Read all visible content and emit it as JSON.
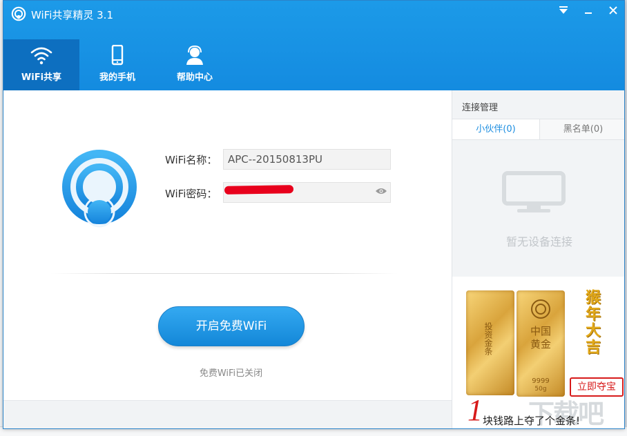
{
  "window": {
    "title": "WiFi共享精灵 3.1"
  },
  "nav": {
    "tabs": [
      {
        "label": "WiFi共享",
        "icon": "wifi-icon",
        "active": true
      },
      {
        "label": "我的手机",
        "icon": "phone-icon",
        "active": false
      },
      {
        "label": "帮助中心",
        "icon": "support-agent-icon",
        "active": false
      }
    ]
  },
  "main": {
    "wifi_name_label": "WiFi名称：",
    "wifi_name_value": "APC--20150813PU",
    "wifi_password_label": "WiFi密码：",
    "start_button": "开启免费WiFi",
    "status": "免费WiFi已关闭"
  },
  "side": {
    "title": "连接管理",
    "tabs": [
      {
        "label": "小伙伴(0)",
        "active": true
      },
      {
        "label": "黑名单(0)",
        "active": false
      }
    ],
    "empty_text": "暂无设备连接"
  },
  "ad": {
    "bar1_text": "投资金条",
    "bar2_text": "中国黄金",
    "bar2_weight": "9999",
    "bar2_grams": "50g",
    "slogan": "猴年大吉",
    "button": "立即夺宝",
    "number": "1",
    "caption": "块钱路上夺了个金条!",
    "watermark": "下载吧"
  },
  "colors": {
    "titlebar": "#148be0",
    "active_tab": "#0d6fc0",
    "accent": "#1b8de0",
    "redaction": "#e8001c",
    "ad_red": "#d71a1a"
  }
}
